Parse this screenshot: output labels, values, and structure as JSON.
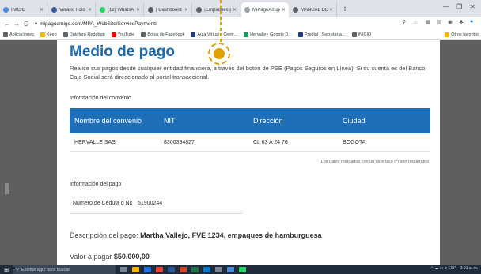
{
  "browser": {
    "tabs": [
      {
        "label": "INICIO",
        "color": "#4a89dc"
      },
      {
        "label": "Verano Foto de Pe",
        "color": "#3b5998"
      },
      {
        "label": "(12) WhatsApp",
        "color": "#25d366"
      },
      {
        "label": "| Dashboard",
        "color": "#5f6368"
      },
      {
        "label": "¡Empaques para ",
        "color": "#5f6368"
      },
      {
        "label": "MiPagoAmigo",
        "color": "#9aa0a6"
      },
      {
        "label": "MANUAL DE RUT",
        "color": "#5f6368"
      }
    ],
    "url": "mipagoamigo.com/MPA_WebSite/ServicePayments",
    "bookmarks": [
      {
        "label": "Aplicaciones",
        "color": "#5f6368"
      },
      {
        "label": "Keep",
        "color": "#f4b400"
      },
      {
        "label": "Dataforo Redeban",
        "color": "#5f6368"
      },
      {
        "label": "YouTube",
        "color": "#ff0000"
      },
      {
        "label": "Bolsa de Facebook",
        "color": "#5f6368"
      },
      {
        "label": "Aula Virtual - Centr...",
        "color": "#1e3a8a"
      },
      {
        "label": "Hervalle - Google D...",
        "color": "#0f9d58"
      },
      {
        "label": "Predial | Secretaría...",
        "color": "#1e3a8a"
      },
      {
        "label": "INICIO",
        "color": "#5f6368"
      }
    ],
    "other_bookmarks": "Otros favoritos"
  },
  "modal": {
    "title": "Medio de pago",
    "description": "Realice sus pagos desde cualquier entidad financiera, a través del botón de PSE (Pagos Seguros en Línea). Si su cuenta es del Banco Caja Social será direccionado al portal transaccional.",
    "convenio_section": "Información del convenio",
    "table": {
      "headers": [
        "Nombre del convenio",
        "NIT",
        "Dirección",
        "Ciudad"
      ],
      "row": [
        "HERVALLE SAS",
        "8300394827",
        "CL 63 A 24 76",
        "BOGOTA"
      ]
    },
    "required_note_pre": "Los datos marcados con un asterisco (",
    "required_note_ast": "*",
    "required_note_post": ") son requeridos",
    "pago_section": "Información del pago",
    "cedula_label": "Numero de Cedula o Nit",
    "cedula_value": "51900244",
    "descripcion_label": "Descripción del pago:",
    "descripcion_value": "Martha Vallejo, FVE 1234, empaques de hamburguesa",
    "valor_label": "Valor a pagar",
    "valor_value": "$50.000,00"
  },
  "taskbar": {
    "search_placeholder": "Escribe aquí para buscar",
    "tray_text": "ESP",
    "time": "3:01 a. m."
  },
  "colors": {
    "accent": "#1e6fb8",
    "title": "#1e6aac",
    "marker": "#e1a100"
  }
}
